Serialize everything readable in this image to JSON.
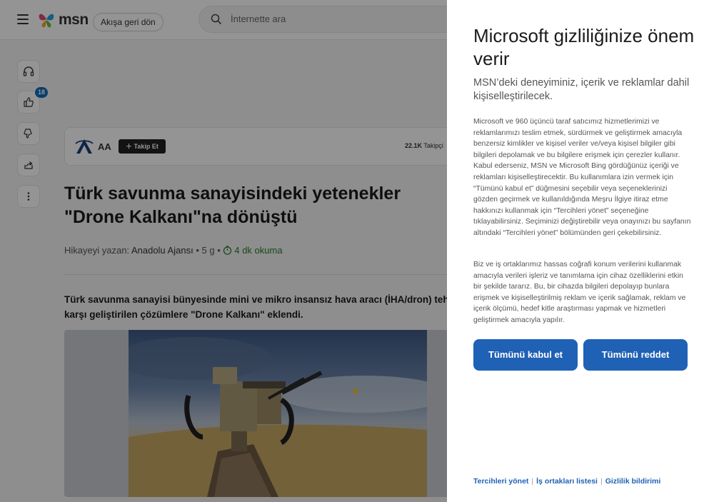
{
  "topbar": {
    "logo_text": "msn",
    "back_label": "Akışa geri dön",
    "search_placeholder": "İnternette ara"
  },
  "rail": {
    "items": [
      {
        "icon": "headphones-icon"
      },
      {
        "icon": "thumbs-up-icon",
        "badge": "18"
      },
      {
        "icon": "thumbs-down-icon"
      },
      {
        "icon": "share-icon"
      },
      {
        "icon": "more-options-icon"
      }
    ]
  },
  "source": {
    "name": "AA",
    "follow_label": "Takip Et",
    "followers_count": "22.1K",
    "followers_label": "Takipçi"
  },
  "article": {
    "headline": "Türk savunma sanayisindeki yetenekler \"Drone Kalkanı\"na dönüştü",
    "byline_prefix": "Hikayeyi yazan:",
    "author": "Anadolu Ajansı",
    "age": "5 g",
    "read_time": "4 dk okuma",
    "lede": "Türk savunma sanayisi bünyesinde mini ve mikro insansız hava aracı (İHA/dron) tehdit karşı geliştirilen çözümlere \"Drone Kalkanı\" eklendi."
  },
  "privacy": {
    "title": "Microsoft gizliliğinize önem verir",
    "subtitle": "MSN’deki deneyiminiz, içerik ve reklamlar dahil kişiselleştirilecek.",
    "body1": "Microsoft ve 960 üçüncü taraf satıcımız hizmetlerimizi ve reklamlarımızı teslim etmek, sürdürmek ve geliştirmek amacıyla benzersiz kimlikler ve kişisel veriler ve/veya kişisel bilgiler gibi bilgileri depolamak ve bu bilgilere erişmek için çerezler kullanır. Kabul ederseniz, MSN ve Microsoft Bing gördüğünüz içeriği ve reklamları kişiselleştirecektir. Bu kullanımlara izin vermek için “Tümünü kabul et” düğmesini seçebilir veya seçeneklerinizi gözden geçirmek ve kullanıldığında Meşru İlgiye itiraz etme hakkınızı kullanmak için “Tercihleri yönet” seçeneğine tıklayabilirsiniz. Seçiminizi değiştirebilir veya onayınızı bu sayfanın altındaki “Tercihleri yönet” bölümünden geri çekebilirsiniz.",
    "body2": "Biz ve iş ortaklarımız hassas coğrafi konum verilerini kullanmak amacıyla verileri işleriz ve tanımlama için cihaz özelliklerini etkin bir şekilde tararız. Bu, bir cihazda bilgileri depolayıp bunlara erişmek ve kişiselleştirilmiş reklam ve içerik sağlamak, reklam ve içerik ölçümü, hedef kitle araştırması yapmak ve hizmetleri geliştirmek amacıyla yapılır.",
    "accept_label": "Tümünü kabul et",
    "reject_label": "Tümünü reddet",
    "links": {
      "preferences": "Tercihleri yönet",
      "partners": "İş ortakları listesi",
      "privacy": "Gizlilik bildirimi"
    }
  },
  "colors": {
    "primary_button": "#1f61b5",
    "badge": "#0f6cbd",
    "overlay": "rgba(0,0,0,0.42)"
  }
}
